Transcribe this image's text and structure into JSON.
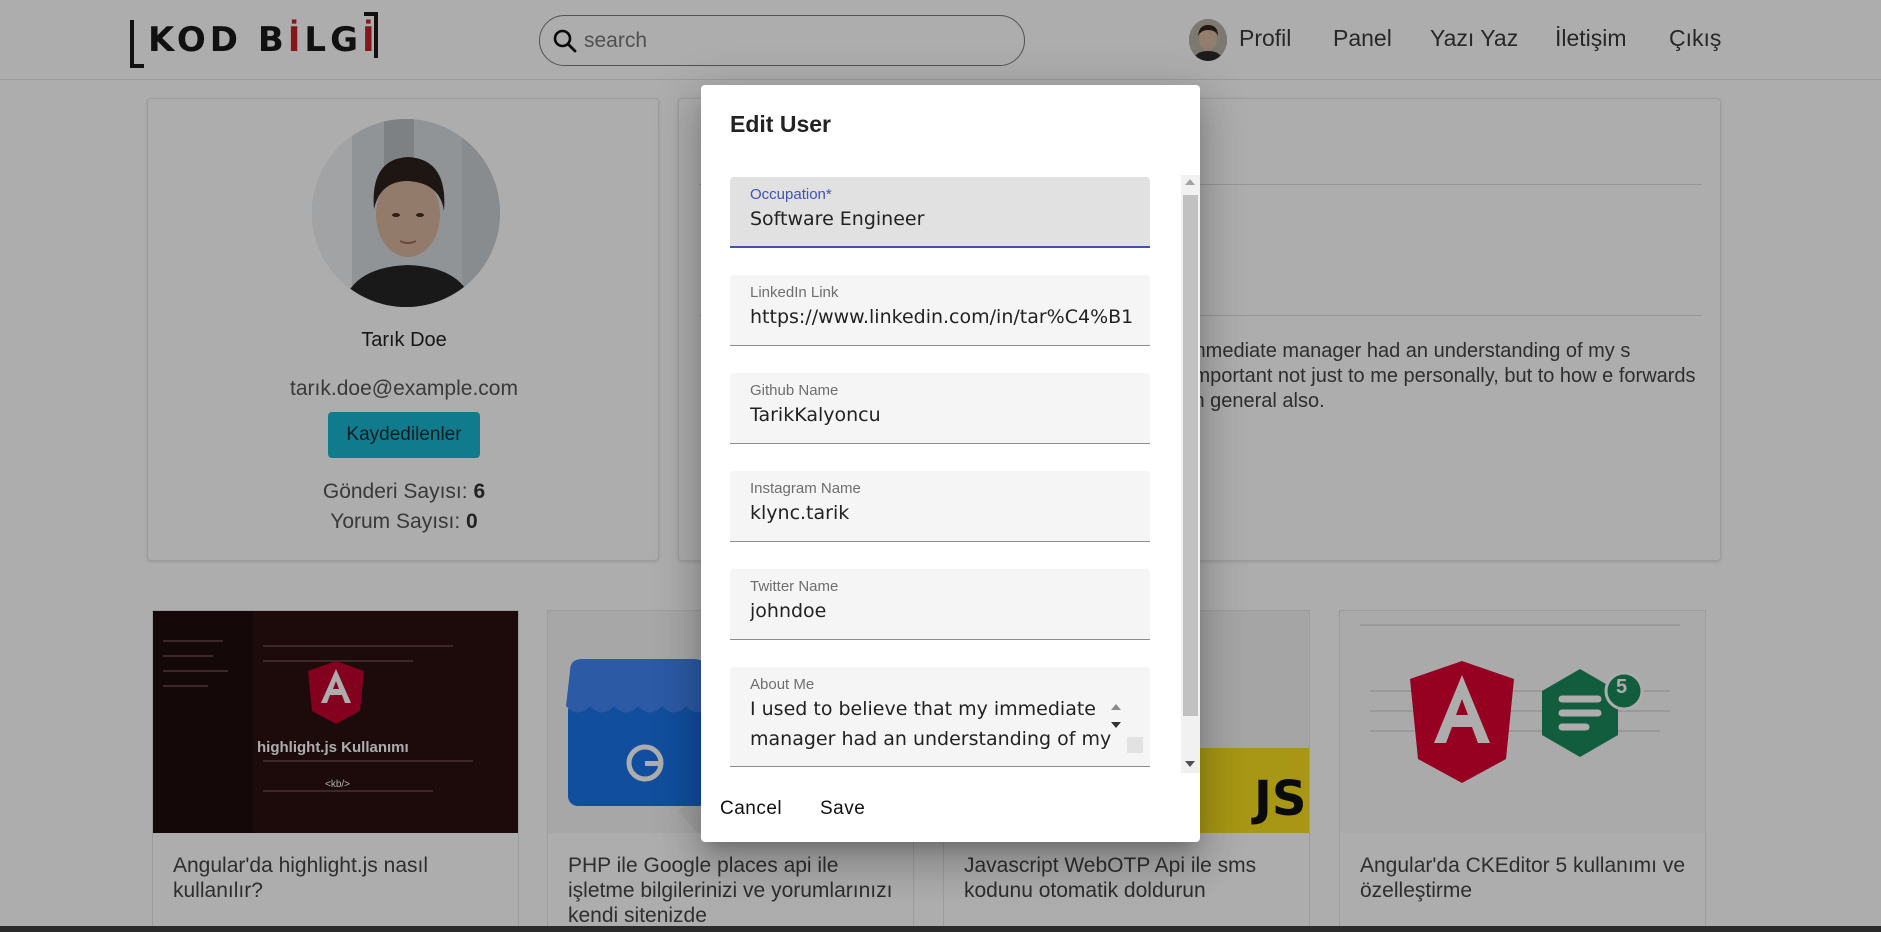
{
  "navbar": {
    "logo_text": "KOD BİLGİ",
    "search_placeholder": "search",
    "links": [
      "Profil",
      "Panel",
      "Yazı Yaz",
      "İletişim",
      "Çıkış"
    ]
  },
  "profile": {
    "name": "Tarık Doe",
    "email": "tarık.doe@example.com",
    "saved_button": "Kaydedilenler",
    "posts_label": "Gönderi Sayısı:",
    "posts_count": "6",
    "comments_label": "Yorum Sayısı:",
    "comments_count": "0"
  },
  "detail": {
    "about_text": "mmediate manager had an understanding of my s important not just to me personally, but to how e forwards in general also."
  },
  "posts": [
    {
      "title": "Angular'da highlight.js nasıl kullanılır?",
      "thumb_caption": "highlight.js Kullanımı",
      "thumb_sub": "<kb/>"
    },
    {
      "title": "PHP ile Google places api ile işletme bilgilerinizi ve yorumlarınızı kendi sitenizde"
    },
    {
      "title": "Javascript WebOTP Api ile sms kodunu otomatik doldurun",
      "thumb_caption": "JS"
    },
    {
      "title": "Angular'da CKEditor 5 kullanımı ve özelleştirme",
      "badge": "5"
    }
  ],
  "dialog": {
    "title": "Edit User",
    "fields": [
      {
        "label": "Occupation*",
        "value": "Software Engineer"
      },
      {
        "label": "LinkedIn Link",
        "value": "https://www.linkedin.com/in/tar%C4%B1"
      },
      {
        "label": "Github Name",
        "value": "TarikKalyoncu"
      },
      {
        "label": "Instagram Name",
        "value": "klync.tarik"
      },
      {
        "label": "Twitter Name",
        "value": "johndoe"
      },
      {
        "label": "About Me",
        "value": "I used to believe that my immediate manager had an understanding of my"
      }
    ],
    "cancel_label": "Cancel",
    "save_label": "Save"
  },
  "colors": {
    "accent": "#1ab5d1",
    "focus": "#3f51b5",
    "logo_red": "#c2222a",
    "angular_red": "#dd0031",
    "ckeditor_green": "#1b8a5a",
    "js_yellow": "#f7df1e"
  }
}
